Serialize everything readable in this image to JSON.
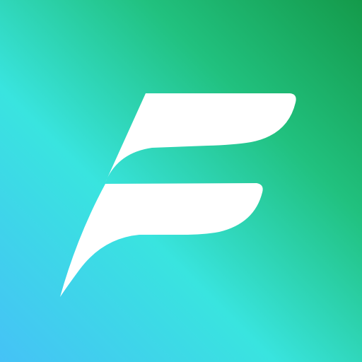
{
  "app_icon": {
    "name": "E-mark app icon",
    "mark": "stylized-letter-e-logo",
    "colors": {
      "gradient_dark_green": "#149a4a",
      "gradient_mid_green": "#21c17f",
      "gradient_cyan": "#39e4df",
      "gradient_blue": "#45c2f6",
      "mark_fill": "#ffffff"
    }
  }
}
